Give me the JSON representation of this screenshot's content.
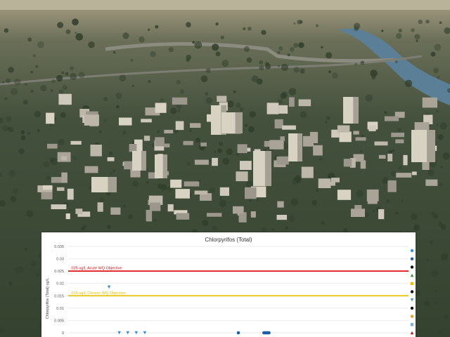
{
  "photo": {
    "sky_color": "#b9b39a",
    "river_color": "#5a7f97",
    "tree_color": "#2f3d2b",
    "building_color": "#cfc9bd"
  },
  "chart_data": {
    "type": "scatter",
    "title": "Chlorpyrifos (Total)",
    "ylabel": "Chlorpyrifos (Total) ug/L",
    "xlabel": "",
    "ylim": [
      0,
      0.035
    ],
    "yticks": [
      "0",
      "0.005",
      "0.01",
      "0.015",
      "0.02",
      "0.025",
      "0.03",
      "0.035"
    ],
    "grid": true,
    "thresholds": [
      {
        "label": ".025 ug/L Acute WQ Objective",
        "value": 0.025,
        "color": "#dd1111"
      },
      {
        "label": ".015 ug/L Chronic WQ Objective",
        "value": 0.015,
        "color": "#e8c100"
      }
    ],
    "series": [
      {
        "marker": "triangle-down",
        "color": "#3a8fd8",
        "points": [
          {
            "x": 0.12,
            "y": 0.0185
          },
          {
            "x": 0.15,
            "y": 0.0
          },
          {
            "x": 0.175,
            "y": 0.0
          },
          {
            "x": 0.2,
            "y": 0.0
          },
          {
            "x": 0.225,
            "y": 0.0
          }
        ]
      },
      {
        "marker": "circle",
        "color": "#1f5fa8",
        "points": [
          {
            "x": 0.5,
            "y": 0.0
          },
          {
            "x": 0.575,
            "y": 0.0
          },
          {
            "x": 0.578,
            "y": 0.0
          },
          {
            "x": 0.581,
            "y": 0.0
          },
          {
            "x": 0.584,
            "y": 0.0
          },
          {
            "x": 0.587,
            "y": 0.0
          },
          {
            "x": 0.59,
            "y": 0.0
          }
        ]
      }
    ],
    "legend_markers": [
      {
        "shape": "circle",
        "color": "#3a8fd8"
      },
      {
        "shape": "circle",
        "color": "#1f5fa8"
      },
      {
        "shape": "circle",
        "color": "#111111"
      },
      {
        "shape": "triangle-up",
        "color": "#2e8b2e"
      },
      {
        "shape": "square",
        "color": "#e8c100"
      },
      {
        "shape": "circle",
        "color": "#111111"
      },
      {
        "shape": "triangle-down",
        "color": "#3a8fd8"
      },
      {
        "shape": "circle",
        "color": "#111111"
      },
      {
        "shape": "circle",
        "color": "#e8a020"
      },
      {
        "shape": "square",
        "color": "#7fb2e0"
      },
      {
        "shape": "triangle-up",
        "color": "#cc1111"
      }
    ]
  }
}
